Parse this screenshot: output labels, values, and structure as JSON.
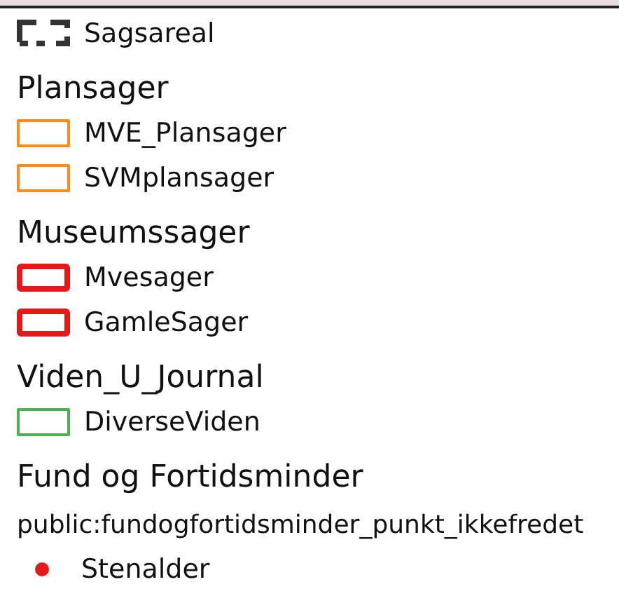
{
  "legend": [
    {
      "kind": "dashed_box",
      "label": "Sagsareal",
      "color": "#333333"
    },
    {
      "kind": "group",
      "label": "Plansager"
    },
    {
      "kind": "outline",
      "label": "MVE_Plansager",
      "color": "#ff8c1a"
    },
    {
      "kind": "outline",
      "label": "SVMplansager",
      "color": "#ff8c1a"
    },
    {
      "kind": "group",
      "label": "Museumssager"
    },
    {
      "kind": "thick_outline",
      "label": "Mvesager",
      "color": "#e31a1c"
    },
    {
      "kind": "thick_outline",
      "label": "GamleSager",
      "color": "#e31a1c"
    },
    {
      "kind": "group",
      "label": "Viden_U_Journal"
    },
    {
      "kind": "outline",
      "label": "DiverseViden",
      "color": "#4caf50"
    },
    {
      "kind": "group",
      "label": "Fund og Fortidsminder"
    },
    {
      "kind": "sublayer",
      "label": "public:fundogfortidsminder_punkt_ikkefredet"
    },
    {
      "kind": "dot",
      "label": "Stenalder",
      "color": "#e31a1c"
    }
  ]
}
